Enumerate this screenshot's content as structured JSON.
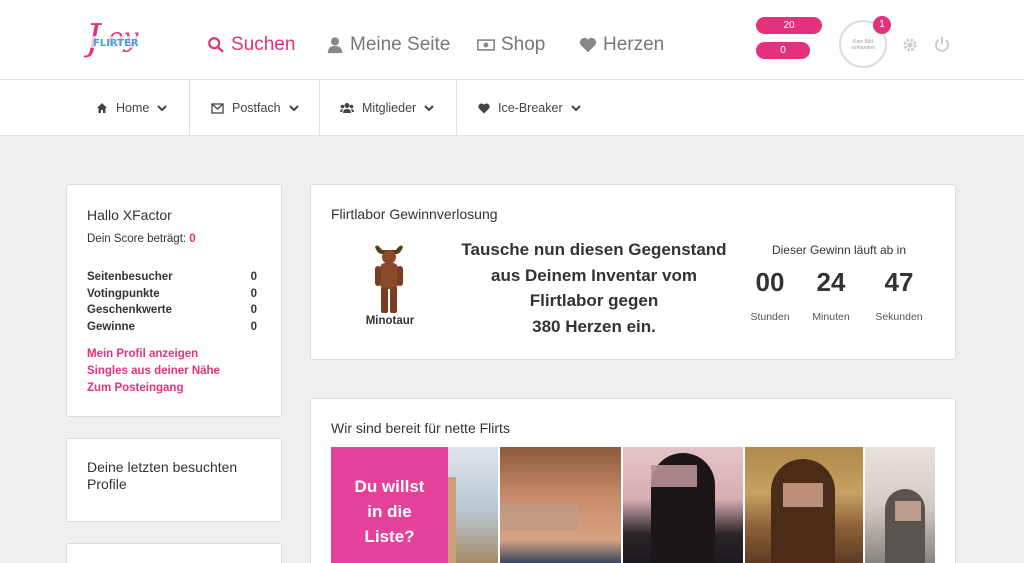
{
  "header": {
    "logo_text": "Joy FLIRTER",
    "nav": [
      {
        "label": "Suchen",
        "icon": "search-icon"
      },
      {
        "label": "Meine Seite",
        "icon": "user-icon"
      },
      {
        "label": "Shop",
        "icon": "money-icon"
      },
      {
        "label": "Herzen",
        "icon": "heart-icon"
      }
    ],
    "flirtchips": "20 Flirtchips",
    "herzen": "0 Herzen",
    "avatar_text": "Kein Bild vorhanden",
    "notification_count": "1",
    "accent": "#e5307e"
  },
  "subnav": [
    {
      "label": "Home",
      "icon": "home-icon"
    },
    {
      "label": "Postfach",
      "icon": "envelope-icon"
    },
    {
      "label": "Mitglieder",
      "icon": "users-icon"
    },
    {
      "label": "Ice-Breaker",
      "icon": "heart-icon"
    }
  ],
  "sidebar": {
    "greeting": "Hallo XFactor",
    "score_label": "Dein Score beträgt:",
    "score_value": "0",
    "stats": [
      {
        "label": "Seitenbesucher",
        "value": "0"
      },
      {
        "label": "Votingpunkte",
        "value": "0"
      },
      {
        "label": "Geschenkwerte",
        "value": "0"
      },
      {
        "label": "Gewinne",
        "value": "0"
      }
    ],
    "links": [
      "Mein Profil anzeigen",
      "Singles aus deiner Nähe",
      "Zum Posteingang"
    ],
    "recent_title": "Deine letzten besuchten Profile"
  },
  "lottery": {
    "title": "Flirtlabor Gewinnverlosung",
    "item_name": "Minotaur",
    "message": [
      "Tausche nun diesen Gegenstand",
      "aus Deinem Inventar vom",
      "Flirtlabor gegen",
      "380 Herzen ein."
    ],
    "countdown_title": "Dieser Gewinn läuft ab in",
    "countdown": [
      {
        "value": "00",
        "unit": "Stunden"
      },
      {
        "value": "24",
        "unit": "Minuten"
      },
      {
        "value": "47",
        "unit": "Sekunden"
      }
    ]
  },
  "flirts": {
    "title": "Wir sind bereit für nette Flirts",
    "cta": [
      "Du willst",
      "in die",
      "Liste?"
    ]
  }
}
